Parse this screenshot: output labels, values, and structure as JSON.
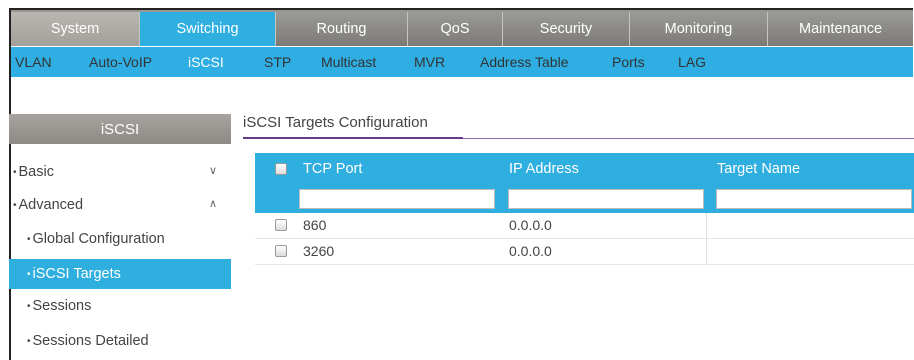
{
  "top_tabs": [
    {
      "label": "System",
      "active": false
    },
    {
      "label": "Switching",
      "active": true
    },
    {
      "label": "Routing",
      "active": false
    },
    {
      "label": "QoS",
      "active": false
    },
    {
      "label": "Security",
      "active": false
    },
    {
      "label": "Monitoring",
      "active": false
    },
    {
      "label": "Maintenance",
      "active": false
    }
  ],
  "sub_nav": [
    {
      "label": "VLAN",
      "active": false
    },
    {
      "label": "Auto-VoIP",
      "active": false
    },
    {
      "label": "iSCSI",
      "active": true
    },
    {
      "label": "STP",
      "active": false
    },
    {
      "label": "Multicast",
      "active": false
    },
    {
      "label": "MVR",
      "active": false
    },
    {
      "label": "Address Table",
      "active": false
    },
    {
      "label": "Ports",
      "active": false
    },
    {
      "label": "LAG",
      "active": false
    }
  ],
  "sidebar": {
    "title": "iSCSI",
    "items": [
      {
        "label": "Basic",
        "bullet": "•",
        "chevron": "∨"
      },
      {
        "label": "Advanced",
        "bullet": "•",
        "chevron": "∧"
      },
      {
        "label": "Global Configuration",
        "bullet": "•"
      },
      {
        "label": "iSCSI Targets",
        "bullet": "•",
        "active": true
      },
      {
        "label": "Sessions",
        "bullet": "•"
      },
      {
        "label": "Sessions Detailed",
        "bullet": "•"
      }
    ]
  },
  "main": {
    "title": "iSCSI Targets Configuration",
    "columns": [
      "TCP Port",
      "IP Address",
      "Target Name"
    ],
    "rows": [
      {
        "tcp_port": "860",
        "ip_address": "0.0.0.0",
        "target_name": ""
      },
      {
        "tcp_port": "3260",
        "ip_address": "0.0.0.0",
        "target_name": ""
      }
    ],
    "filters": {
      "tcp_port": "",
      "ip_address": "",
      "target_name": ""
    }
  },
  "colors": {
    "accent": "#2faee0",
    "tab_gray": "#8a8782",
    "title_underline": "#6a3b8a"
  }
}
